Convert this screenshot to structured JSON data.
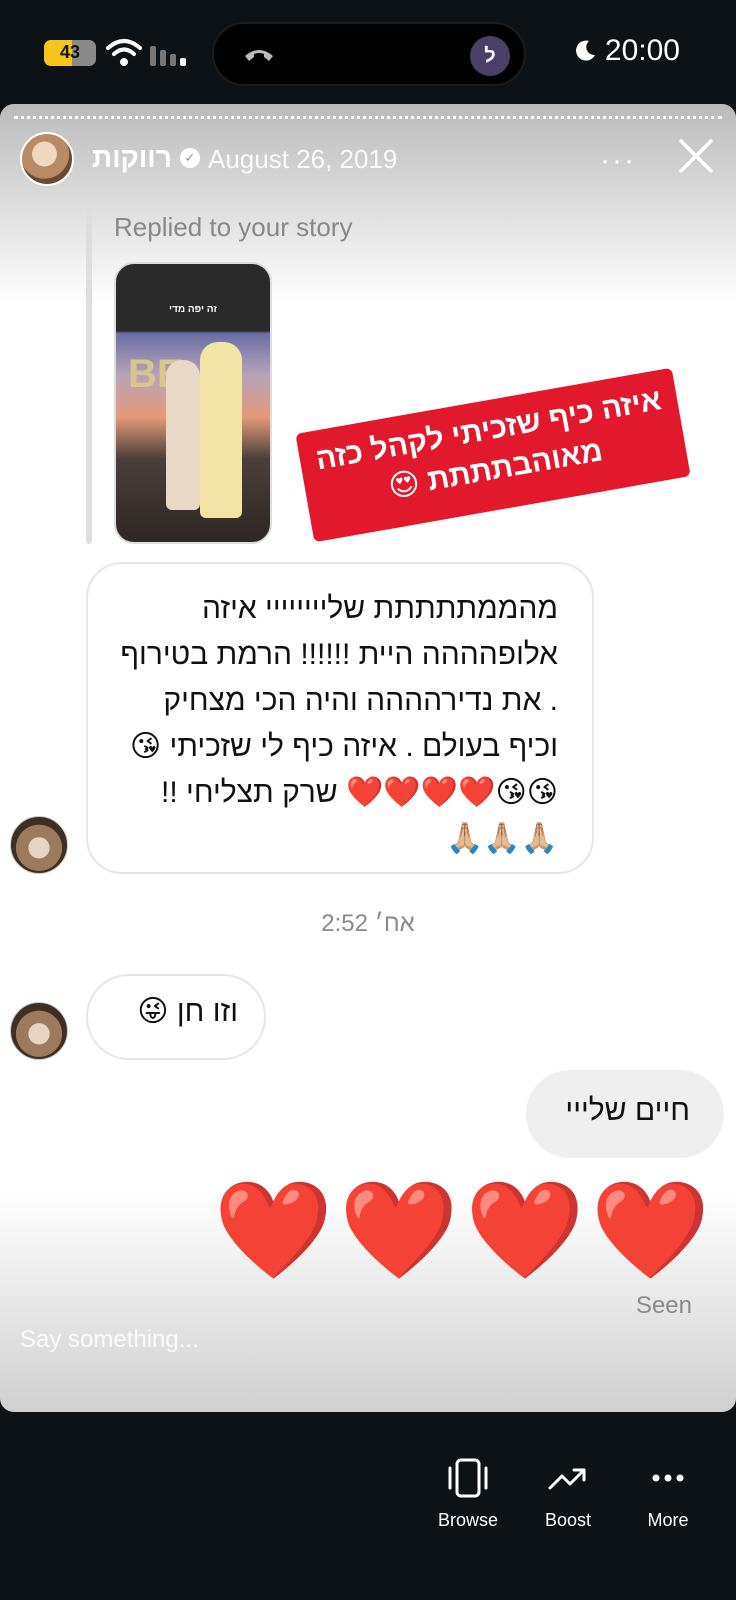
{
  "status_bar": {
    "battery": "43",
    "island_initial": "ל",
    "time": "20:00"
  },
  "story": {
    "username": "רווקות",
    "date": "August 26, 2019",
    "more_label": "···",
    "reply_label": "Replied to your story",
    "thumb_text": "זה יפה מדי",
    "thumb_balloon": "BE",
    "sticker_text": "איזה כיף שזכיתי לקהל כזה מאוהבתתתת 😍"
  },
  "messages": [
    {
      "text": "מהממתתתתת שליייייייי איזה אלופהההה היית !!!!!! הרמת בטירוף . את נדירהההה והיה הכי מצחיק וכיף בעולם . איזה כיף לי שזכיתי 😘😘😘❤️❤️❤️❤️ שרק תצליחי !! 🙏🏼🙏🏼🙏🏼"
    },
    {
      "text": "וזו חן 😜"
    },
    {
      "text": "חיים שלייי"
    }
  ],
  "timestamp": "2:52 אח׳",
  "hearts": "❤️❤️❤️❤️",
  "seen": "Seen",
  "composer_placeholder": "Say something...",
  "nav": {
    "browse": "Browse",
    "boost": "Boost",
    "more": "More"
  }
}
